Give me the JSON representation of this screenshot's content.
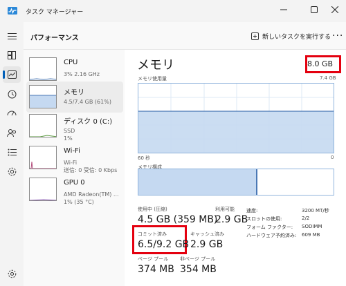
{
  "window": {
    "title": "タスク マネージャー"
  },
  "header": {
    "title": "パフォーマンス",
    "run_task_label": "新しいタスクを実行する",
    "more_label": "..."
  },
  "nav": {
    "items": [
      {
        "name": "hamburger-menu-icon"
      },
      {
        "name": "processes-icon"
      },
      {
        "name": "performance-icon"
      },
      {
        "name": "app-history-icon"
      },
      {
        "name": "startup-apps-icon"
      },
      {
        "name": "users-icon"
      },
      {
        "name": "details-icon"
      },
      {
        "name": "services-icon"
      },
      {
        "name": "settings-icon"
      }
    ]
  },
  "resources": [
    {
      "name": "CPU",
      "line1": "3%  2.16 GHz",
      "line2": ""
    },
    {
      "name": "メモリ",
      "line1": "4.5/7.4 GB (61%)",
      "line2": ""
    },
    {
      "name": "ディスク 0 (C:)",
      "line1": "SSD",
      "line2": "1%"
    },
    {
      "name": "Wi-Fi",
      "line1": "Wi-Fi",
      "line2": "送信: 0  受信: 0 Kbps"
    },
    {
      "name": "GPU 0",
      "line1": "AMD Radeon(TM) ...",
      "line2": "1% (35 °C)"
    }
  ],
  "memory": {
    "title": "メモリ",
    "total": "8.0 GB",
    "usage_label": "メモリ使用量",
    "usage_max": "7.4 GB",
    "time_left": "60 秒",
    "time_right": "0",
    "composition_label": "メモリ構成",
    "usage_fraction": 0.61,
    "stats": {
      "in_use_label": "使用中 (圧縮)",
      "in_use_value": "4.5 GB (359 MB)",
      "available_label": "利用可能",
      "available_value": "2.9 GB",
      "committed_label": "コミット済み",
      "committed_value": "6.5/9.2 GB",
      "cached_label": "キャッシュ済み",
      "cached_value": "2.9 GB",
      "paged_label": "ページ プール",
      "paged_value": "374 MB",
      "nonpaged_label": "非ページ プール",
      "nonpaged_value": "354 MB"
    },
    "details": [
      {
        "label": "速度:",
        "value": "3200 MT/秒"
      },
      {
        "label": "スロットの使用:",
        "value": "2/2"
      },
      {
        "label": "フォーム ファクター:",
        "value": "SODIMM"
      },
      {
        "label": "ハードウェア予約済み:",
        "value": "609 MB"
      }
    ]
  },
  "colors": {
    "accent": "#005fb8",
    "memory_fill": "#c5d9f1",
    "memory_line": "#4a78b5",
    "highlight": "#e4000f"
  }
}
